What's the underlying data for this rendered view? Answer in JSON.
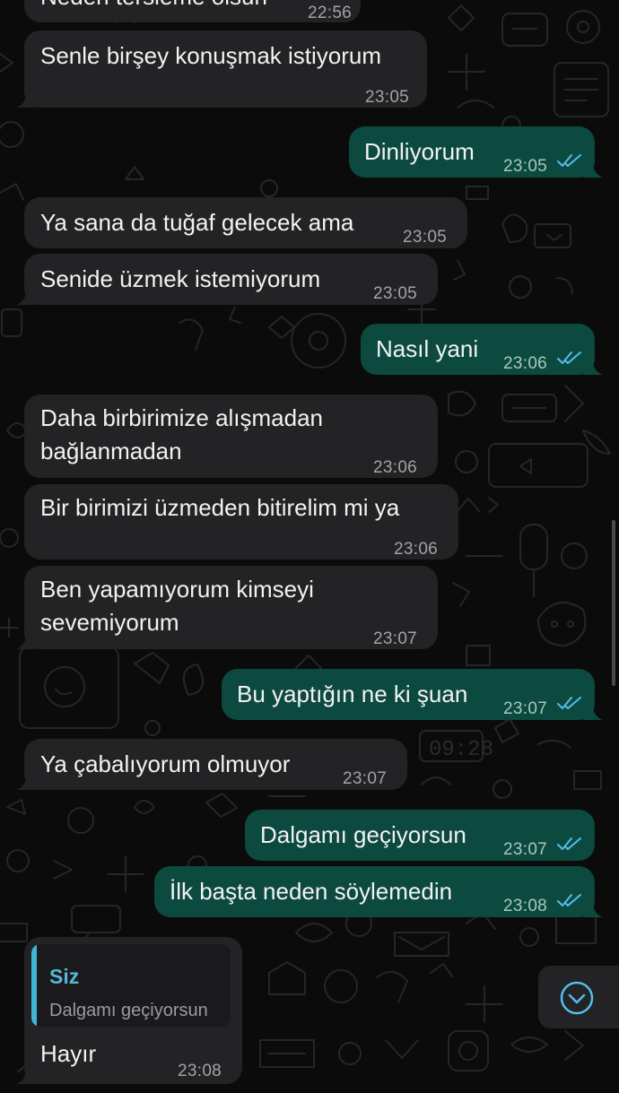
{
  "messages": [
    {
      "dir": "in",
      "text": "Neden tersleme olsun",
      "time": "22:56"
    },
    {
      "dir": "in",
      "text": "Senle birşey konuşmak istiyorum",
      "time": "23:05"
    },
    {
      "dir": "out",
      "text": "Dinliyorum",
      "time": "23:05",
      "read": true
    },
    {
      "dir": "in",
      "text": "Ya sana da tuğaf gelecek ama",
      "time": "23:05"
    },
    {
      "dir": "in",
      "text": "Senide üzmek istemiyorum",
      "time": "23:05"
    },
    {
      "dir": "out",
      "text": "Nasıl yani",
      "time": "23:06",
      "read": true
    },
    {
      "dir": "in",
      "text": "Daha birbirimize alışmadan\nbağlanmadan",
      "time": "23:06"
    },
    {
      "dir": "in",
      "text": "Bir birimizi üzmeden bitirelim mi ya",
      "time": "23:06"
    },
    {
      "dir": "in",
      "text": "Ben yapamıyorum kimseyi\nsevemiyorum",
      "time": "23:07"
    },
    {
      "dir": "out",
      "text": "Bu yaptığın ne ki şuan",
      "time": "23:07",
      "read": true
    },
    {
      "dir": "in",
      "text": "Ya çabalıyorum olmuyor",
      "time": "23:07"
    },
    {
      "dir": "out",
      "text": "Dalgamı geçiyorsun",
      "time": "23:07",
      "read": true
    },
    {
      "dir": "out",
      "text": "İlk başta neden söylemedin",
      "time": "23:08",
      "read": true
    },
    {
      "dir": "in",
      "text": "Hayır",
      "time": "23:08",
      "quote": {
        "author": "Siz",
        "text": "Dalgamı geçiyorsun"
      }
    }
  ],
  "wallpaper_clock_text": "09:28",
  "icons": {
    "read_ticks": "double-check-icon",
    "scroll_down": "chevron-down-circle-icon"
  },
  "colors": {
    "background": "#0b0b0b",
    "incoming_bubble": "#232325",
    "outgoing_bubble": "#0c4a40",
    "read_ticks": "#53bdeb",
    "quote_accent": "#3fb6d6"
  }
}
